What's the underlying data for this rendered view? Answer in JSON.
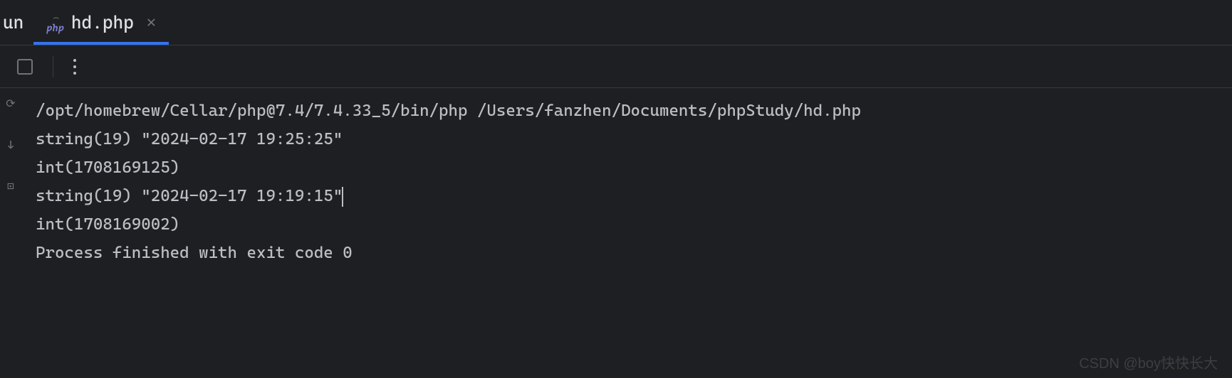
{
  "tabs": {
    "partial_left": "un",
    "active": {
      "icon_label": "php",
      "filename": "hd.php"
    }
  },
  "console": {
    "line1": "/opt/homebrew/Cellar/php@7.4/7.4.33_5/bin/php /Users/fanzhen/Documents/phpStudy/hd.php",
    "line2": "string(19) \"2024-02-17 19:25:25\"",
    "line3": "int(1708169125)",
    "line4": "string(19) \"2024-02-17 19:19:15\"",
    "line5": "int(1708169002)",
    "line6": "",
    "line7": "Process finished with exit code 0"
  },
  "watermark": "CSDN @boy快快长大"
}
